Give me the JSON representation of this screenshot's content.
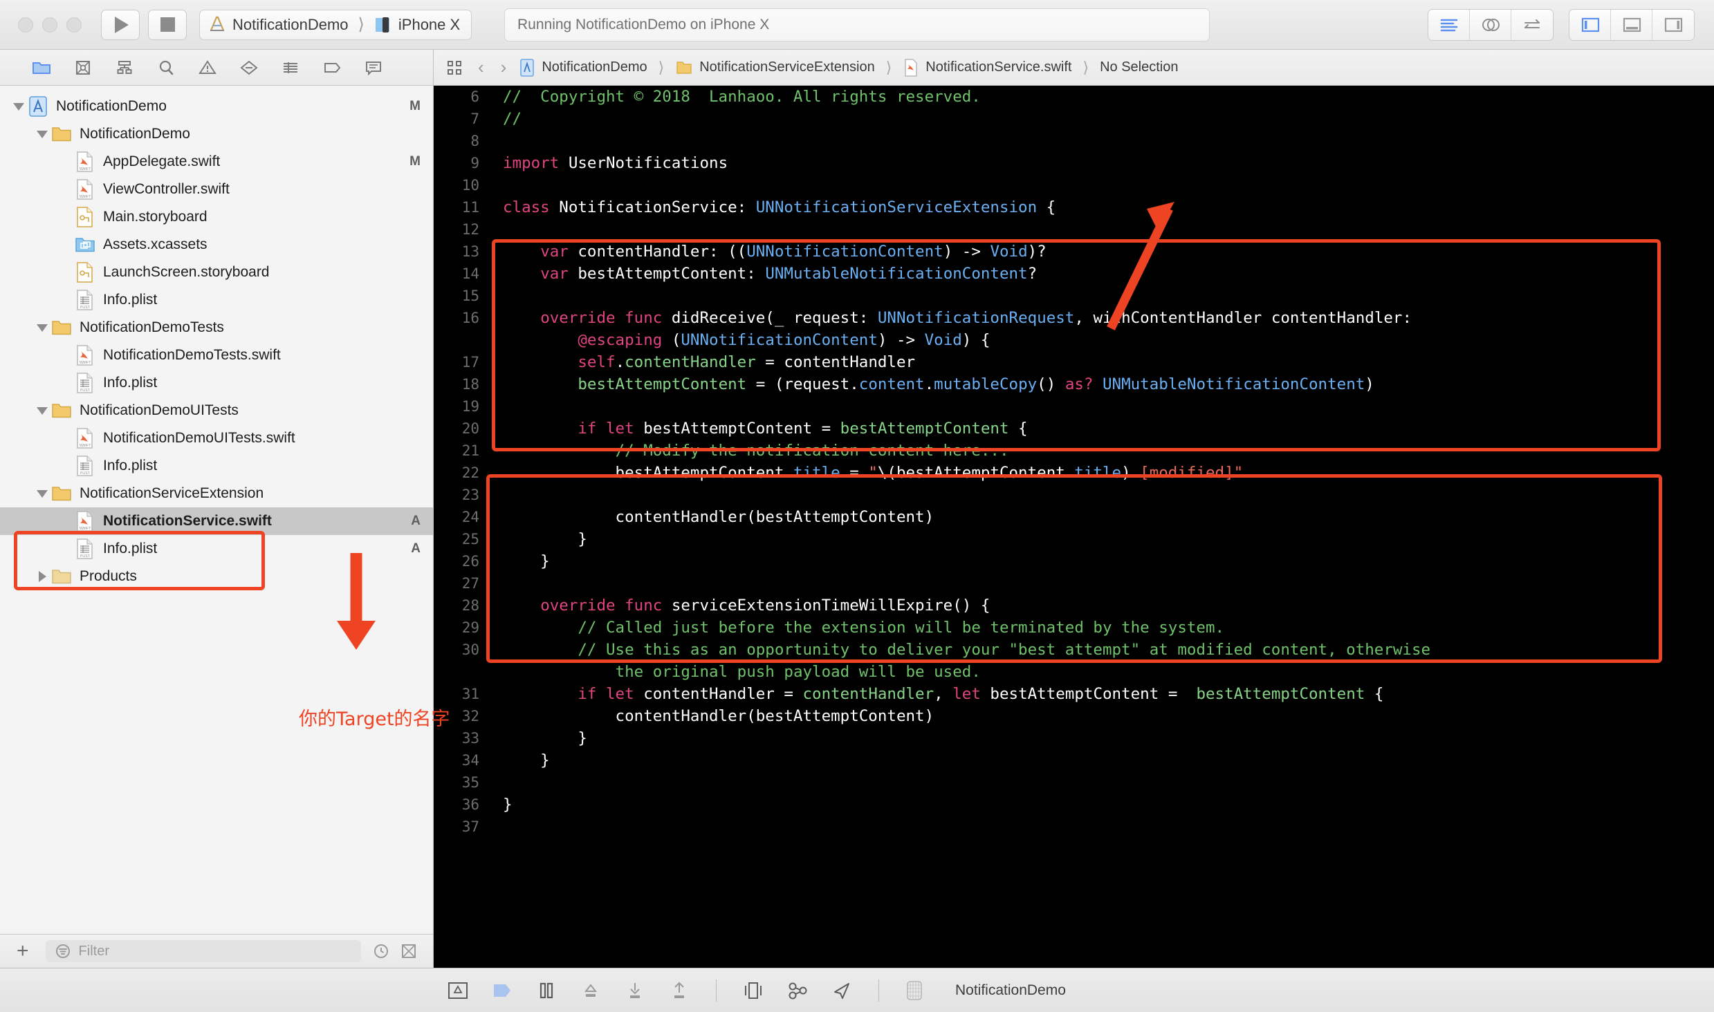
{
  "window": {
    "traffic_lights": [
      "close",
      "minimize",
      "zoom"
    ],
    "run_button": "run",
    "stop_button": "stop",
    "scheme": {
      "project": "NotificationDemo",
      "destination": "iPhone X"
    },
    "status": "Running NotificationDemo on iPhone X",
    "editor_modes": [
      "standard-editor",
      "assistant-editor",
      "version-editor"
    ],
    "view_toggles": [
      "navigator-toggle",
      "debug-area-toggle",
      "utilities-toggle"
    ]
  },
  "navigator": {
    "tabs": [
      "project-navigator",
      "source-control-navigator",
      "symbol-navigator",
      "find-navigator",
      "issue-navigator",
      "test-navigator",
      "debug-navigator",
      "breakpoint-navigator",
      "report-navigator"
    ],
    "tree": [
      {
        "label": "NotificationDemo",
        "icon": "xcode-project-icon",
        "indent": 0,
        "disclosure": "down",
        "status": "M",
        "bold": false
      },
      {
        "label": "NotificationDemo",
        "icon": "folder-icon",
        "indent": 1,
        "disclosure": "down",
        "status": "",
        "bold": false
      },
      {
        "label": "AppDelegate.swift",
        "icon": "swift-file-icon",
        "indent": 2,
        "disclosure": "none",
        "status": "M",
        "bold": false
      },
      {
        "label": "ViewController.swift",
        "icon": "swift-file-icon",
        "indent": 2,
        "disclosure": "none",
        "status": "",
        "bold": false
      },
      {
        "label": "Main.storyboard",
        "icon": "storyboard-icon",
        "indent": 2,
        "disclosure": "none",
        "status": "",
        "bold": false
      },
      {
        "label": "Assets.xcassets",
        "icon": "assets-icon",
        "indent": 2,
        "disclosure": "none",
        "status": "",
        "bold": false
      },
      {
        "label": "LaunchScreen.storyboard",
        "icon": "storyboard-icon",
        "indent": 2,
        "disclosure": "none",
        "status": "",
        "bold": false
      },
      {
        "label": "Info.plist",
        "icon": "plist-icon",
        "indent": 2,
        "disclosure": "none",
        "status": "",
        "bold": false
      },
      {
        "label": "NotificationDemoTests",
        "icon": "folder-icon",
        "indent": 1,
        "disclosure": "down",
        "status": "",
        "bold": false
      },
      {
        "label": "NotificationDemoTests.swift",
        "icon": "swift-file-icon",
        "indent": 2,
        "disclosure": "none",
        "status": "",
        "bold": false
      },
      {
        "label": "Info.plist",
        "icon": "plist-icon",
        "indent": 2,
        "disclosure": "none",
        "status": "",
        "bold": false
      },
      {
        "label": "NotificationDemoUITests",
        "icon": "folder-icon",
        "indent": 1,
        "disclosure": "down",
        "status": "",
        "bold": false
      },
      {
        "label": "NotificationDemoUITests.swift",
        "icon": "swift-file-icon",
        "indent": 2,
        "disclosure": "none",
        "status": "",
        "bold": false
      },
      {
        "label": "Info.plist",
        "icon": "plist-icon",
        "indent": 2,
        "disclosure": "none",
        "status": "",
        "bold": false
      },
      {
        "label": "NotificationServiceExtension",
        "icon": "folder-icon",
        "indent": 1,
        "disclosure": "down",
        "status": "",
        "bold": false
      },
      {
        "label": "NotificationService.swift",
        "icon": "swift-file-icon",
        "indent": 2,
        "disclosure": "none",
        "status": "A",
        "bold": true,
        "selected": true
      },
      {
        "label": "Info.plist",
        "icon": "plist-icon",
        "indent": 2,
        "disclosure": "none",
        "status": "A",
        "bold": false
      },
      {
        "label": "Products",
        "icon": "folder-dim-icon",
        "indent": 1,
        "disclosure": "right",
        "status": "",
        "bold": false
      }
    ],
    "filter": {
      "add_label": "+",
      "placeholder": "Filter",
      "icons": [
        "recent-icon",
        "source-control-filter-icon"
      ]
    }
  },
  "jumpbar": {
    "related_items": "related-items-icon",
    "back": "‹",
    "forward": "›",
    "crumbs": [
      {
        "label": "NotificationDemo",
        "icon": "xcode-project-icon"
      },
      {
        "label": "NotificationServiceExtension",
        "icon": "folder-icon"
      },
      {
        "label": "NotificationService.swift",
        "icon": "swift-file-icon"
      },
      {
        "label": "No Selection",
        "icon": ""
      }
    ]
  },
  "code": {
    "file": "NotificationService.swift",
    "lines": [
      {
        "num": "6",
        "segs": [
          {
            "t": "//  Copyright © 2018  Lanhaoo. All rights reserved.",
            "c": "cmt"
          }
        ]
      },
      {
        "num": "7",
        "segs": [
          {
            "t": "//",
            "c": "cmt"
          }
        ]
      },
      {
        "num": "8",
        "segs": []
      },
      {
        "num": "9",
        "segs": [
          {
            "t": "import",
            "c": "kw"
          },
          {
            "t": " UserNotifications",
            "c": "wht"
          }
        ]
      },
      {
        "num": "10",
        "segs": []
      },
      {
        "num": "11",
        "segs": [
          {
            "t": "class",
            "c": "kw"
          },
          {
            "t": " NotificationService: ",
            "c": "wht"
          },
          {
            "t": "UNNotificationServiceExtension",
            "c": "typ"
          },
          {
            "t": " {",
            "c": "wht"
          }
        ]
      },
      {
        "num": "12",
        "segs": []
      },
      {
        "num": "13",
        "segs": [
          {
            "t": "    ",
            "c": "wht"
          },
          {
            "t": "var",
            "c": "kw"
          },
          {
            "t": " contentHandler: ((",
            "c": "wht"
          },
          {
            "t": "UNNotificationContent",
            "c": "typ"
          },
          {
            "t": ") -> ",
            "c": "wht"
          },
          {
            "t": "Void",
            "c": "typ"
          },
          {
            "t": ")?",
            "c": "wht"
          }
        ]
      },
      {
        "num": "14",
        "segs": [
          {
            "t": "    ",
            "c": "wht"
          },
          {
            "t": "var",
            "c": "kw"
          },
          {
            "t": " bestAttemptContent: ",
            "c": "wht"
          },
          {
            "t": "UNMutableNotificationContent",
            "c": "typ"
          },
          {
            "t": "?",
            "c": "wht"
          }
        ]
      },
      {
        "num": "15",
        "segs": []
      },
      {
        "num": "16",
        "segs": [
          {
            "t": "    ",
            "c": "wht"
          },
          {
            "t": "override func",
            "c": "kw"
          },
          {
            "t": " didReceive(",
            "c": "wht"
          },
          {
            "t": "_",
            "c": "wht"
          },
          {
            "t": " request: ",
            "c": "wht"
          },
          {
            "t": "UNNotificationRequest",
            "c": "typ"
          },
          {
            "t": ", withContentHandler contentHandler:",
            "c": "wht"
          }
        ]
      },
      {
        "num": "",
        "segs": [
          {
            "t": "        ",
            "c": "wht"
          },
          {
            "t": "@escaping",
            "c": "kw"
          },
          {
            "t": " (",
            "c": "wht"
          },
          {
            "t": "UNNotificationContent",
            "c": "typ"
          },
          {
            "t": ") -> ",
            "c": "wht"
          },
          {
            "t": "Void",
            "c": "typ"
          },
          {
            "t": ") {",
            "c": "wht"
          }
        ]
      },
      {
        "num": "17",
        "segs": [
          {
            "t": "        ",
            "c": "wht"
          },
          {
            "t": "self",
            "c": "kw"
          },
          {
            "t": ".",
            "c": "wht"
          },
          {
            "t": "contentHandler",
            "c": "grn"
          },
          {
            "t": " = contentHandler",
            "c": "wht"
          }
        ]
      },
      {
        "num": "18",
        "segs": [
          {
            "t": "        ",
            "c": "wht"
          },
          {
            "t": "bestAttemptContent",
            "c": "grn"
          },
          {
            "t": " = (request.",
            "c": "wht"
          },
          {
            "t": "content",
            "c": "prop"
          },
          {
            "t": ".",
            "c": "wht"
          },
          {
            "t": "mutableCopy",
            "c": "prop"
          },
          {
            "t": "() ",
            "c": "wht"
          },
          {
            "t": "as?",
            "c": "kw"
          },
          {
            "t": " ",
            "c": "wht"
          },
          {
            "t": "UNMutableNotificationContent",
            "c": "typ"
          },
          {
            "t": ")",
            "c": "wht"
          }
        ]
      },
      {
        "num": "19",
        "segs": []
      },
      {
        "num": "20",
        "segs": [
          {
            "t": "        ",
            "c": "wht"
          },
          {
            "t": "if let",
            "c": "kw"
          },
          {
            "t": " bestAttemptContent = ",
            "c": "wht"
          },
          {
            "t": "bestAttemptContent",
            "c": "grn"
          },
          {
            "t": " {",
            "c": "wht"
          }
        ]
      },
      {
        "num": "21",
        "segs": [
          {
            "t": "            ",
            "c": "wht"
          },
          {
            "t": "// Modify the notification content here...",
            "c": "cmt"
          }
        ]
      },
      {
        "num": "22",
        "segs": [
          {
            "t": "            bestAttemptContent.",
            "c": "wht"
          },
          {
            "t": "title",
            "c": "prop"
          },
          {
            "t": " = ",
            "c": "wht"
          },
          {
            "t": "\"",
            "c": "str"
          },
          {
            "t": "\\(bestAttemptContent.",
            "c": "wht"
          },
          {
            "t": "title",
            "c": "prop"
          },
          {
            "t": ")",
            "c": "wht"
          },
          {
            "t": " [modified]\"",
            "c": "str"
          }
        ]
      },
      {
        "num": "23",
        "segs": []
      },
      {
        "num": "24",
        "segs": [
          {
            "t": "            contentHandler(bestAttemptContent)",
            "c": "wht"
          }
        ]
      },
      {
        "num": "25",
        "segs": [
          {
            "t": "        }",
            "c": "wht"
          }
        ]
      },
      {
        "num": "26",
        "segs": [
          {
            "t": "    }",
            "c": "wht"
          }
        ]
      },
      {
        "num": "27",
        "segs": []
      },
      {
        "num": "28",
        "segs": [
          {
            "t": "    ",
            "c": "wht"
          },
          {
            "t": "override func",
            "c": "kw"
          },
          {
            "t": " serviceExtensionTimeWillExpire() {",
            "c": "wht"
          }
        ]
      },
      {
        "num": "29",
        "segs": [
          {
            "t": "        ",
            "c": "wht"
          },
          {
            "t": "// Called just before the extension will be terminated by the system.",
            "c": "cmt"
          }
        ]
      },
      {
        "num": "30",
        "segs": [
          {
            "t": "        ",
            "c": "wht"
          },
          {
            "t": "// Use this as an opportunity to deliver your \"best attempt\" at modified content, otherwise",
            "c": "cmt"
          }
        ]
      },
      {
        "num": "",
        "segs": [
          {
            "t": "            ",
            "c": "wht"
          },
          {
            "t": "the original push payload will be used.",
            "c": "cmt"
          }
        ]
      },
      {
        "num": "31",
        "segs": [
          {
            "t": "        ",
            "c": "wht"
          },
          {
            "t": "if let",
            "c": "kw"
          },
          {
            "t": " contentHandler = ",
            "c": "wht"
          },
          {
            "t": "contentHandler",
            "c": "grn"
          },
          {
            "t": ", ",
            "c": "wht"
          },
          {
            "t": "let",
            "c": "kw"
          },
          {
            "t": " bestAttemptContent =  ",
            "c": "wht"
          },
          {
            "t": "bestAttemptContent",
            "c": "grn"
          },
          {
            "t": " {",
            "c": "wht"
          }
        ]
      },
      {
        "num": "32",
        "segs": [
          {
            "t": "            contentHandler(bestAttemptContent)",
            "c": "wht"
          }
        ]
      },
      {
        "num": "33",
        "segs": [
          {
            "t": "        }",
            "c": "wht"
          }
        ]
      },
      {
        "num": "34",
        "segs": [
          {
            "t": "    }",
            "c": "wht"
          }
        ]
      },
      {
        "num": "35",
        "segs": []
      },
      {
        "num": "36",
        "segs": [
          {
            "t": "}",
            "c": "wht"
          }
        ]
      },
      {
        "num": "37",
        "segs": []
      }
    ]
  },
  "annotations": {
    "target_name_label": "你的Target的名字",
    "accent_color": "#ef4423"
  },
  "debugbar": {
    "icons": [
      "hide-debug-area-icon",
      "continue-icon",
      "pause-icon",
      "step-over-icon",
      "step-into-icon",
      "step-out-icon",
      "view-hierarchy-icon",
      "memory-graph-icon",
      "simulate-location-icon",
      "process-icon"
    ],
    "process": "NotificationDemo"
  }
}
